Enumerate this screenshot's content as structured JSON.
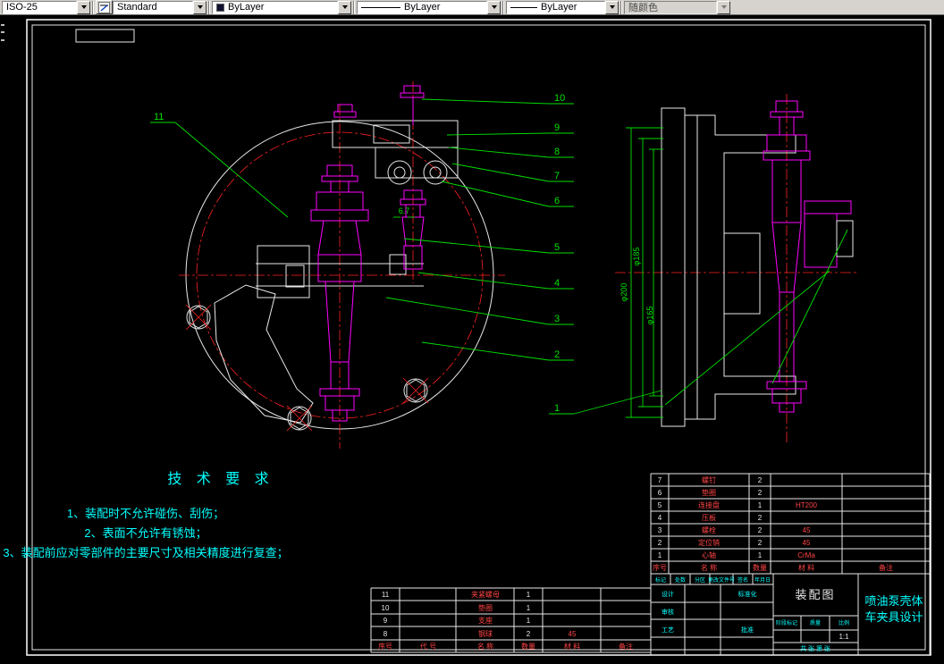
{
  "toolbar": {
    "dim_style": "ISO-25",
    "text_style": "Standard",
    "color": "ByLayer",
    "linetype": "ByLayer",
    "lineweight": "ByLayer",
    "plot_style": "随颜色"
  },
  "drawing": {
    "balloons": [
      "1",
      "2",
      "3",
      "4",
      "5",
      "6",
      "7",
      "8",
      "9",
      "10",
      "11"
    ],
    "dims": {
      "d1": "φ200",
      "d2": "φ185",
      "d3": "φ165",
      "d4": "6.7"
    },
    "tech": {
      "title": "技 术 要 求",
      "item1": "1、装配时不允许碰伤、刮伤；",
      "item2": "2、表面不允许有锈蚀；",
      "item3": "3、装配前应对零部件的主要尺寸及相关精度进行复查；"
    },
    "bom_right": {
      "header": {
        "no": "序号",
        "name": "名  称",
        "qty": "数量",
        "material": "材  料",
        "remark": "备注"
      },
      "rows": [
        {
          "no": "7",
          "name": "螺钉",
          "qty": "2",
          "material": ""
        },
        {
          "no": "6",
          "name": "垫圈",
          "qty": "2",
          "material": ""
        },
        {
          "no": "5",
          "name": "连接盘",
          "qty": "1",
          "material": "HT200"
        },
        {
          "no": "4",
          "name": "压板",
          "qty": "2",
          "material": ""
        },
        {
          "no": "3",
          "name": "螺栓",
          "qty": "2",
          "material": "45"
        },
        {
          "no": "2",
          "name": "定位销",
          "qty": "2",
          "material": "45"
        },
        {
          "no": "1",
          "name": "心轴",
          "qty": "1",
          "material": "CrMa"
        }
      ]
    },
    "bom_left": {
      "header": {
        "no": "序号",
        "code": "代 号",
        "name": "名  称",
        "qty": "数量",
        "material": "材  料",
        "remark": "备注"
      },
      "rows": [
        {
          "no": "11",
          "code": "",
          "name": "夹紧螺母",
          "qty": "1",
          "material": ""
        },
        {
          "no": "10",
          "code": "",
          "name": "垫圈",
          "qty": "1",
          "material": ""
        },
        {
          "no": "9",
          "code": "",
          "name": "支座",
          "qty": "1",
          "material": ""
        },
        {
          "no": "8",
          "code": "",
          "name": "钢球",
          "qty": "2",
          "material": "45"
        }
      ]
    },
    "titleblock": {
      "row1": [
        "标记",
        "处数",
        "分区",
        "更改文件号",
        "签名",
        "年月日"
      ],
      "sign1": "设计",
      "sign2": "审核",
      "sign3": "工艺",
      "sign4": "标准化",
      "sign5": "批准",
      "stage_label": "阶段标记",
      "mass_label": "质量",
      "scale_label": "比例",
      "scale_value": "1:1",
      "sheet_info": "共 张 第 张",
      "title": "装配图",
      "subtitle_line1": "喷油泵壳体",
      "subtitle_line2": "车夹具设计"
    }
  }
}
